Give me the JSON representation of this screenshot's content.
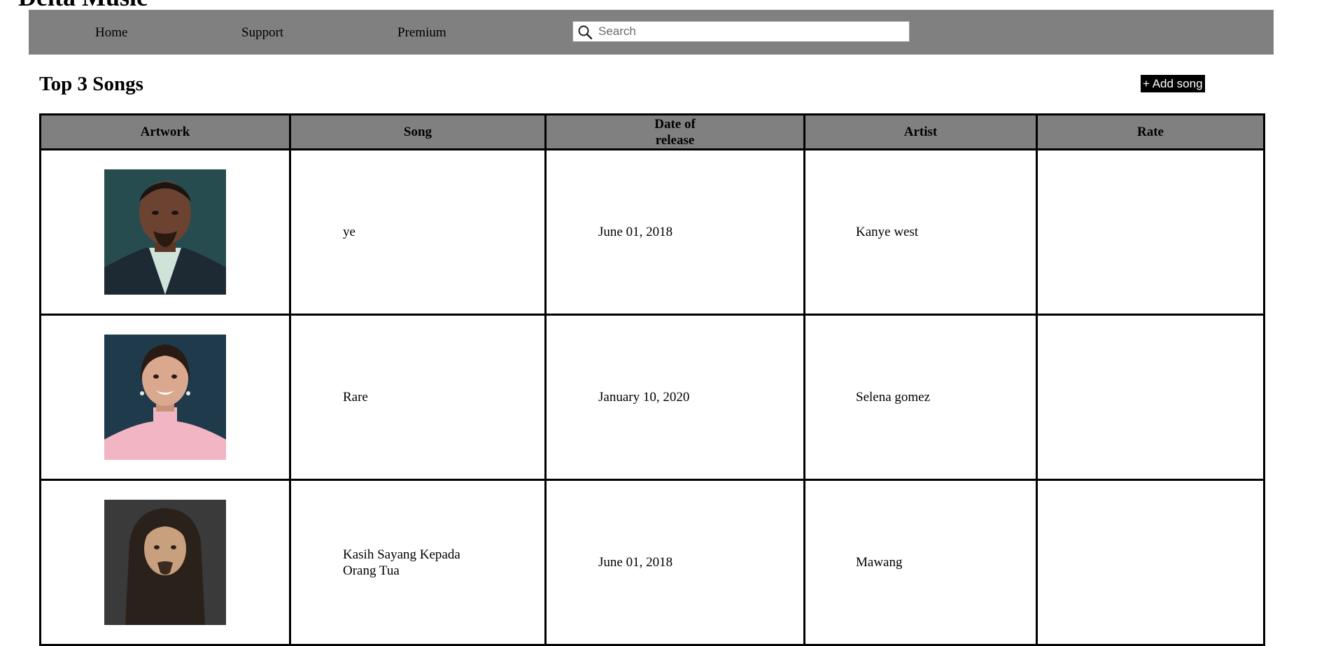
{
  "site": {
    "title": "Delta Music"
  },
  "nav": {
    "items": [
      {
        "label": "Home"
      },
      {
        "label": "Support"
      },
      {
        "label": "Premium"
      }
    ]
  },
  "search": {
    "placeholder": "Search",
    "value": ""
  },
  "main": {
    "heading": "Top 3 Songs",
    "add_button_label": "+ Add song"
  },
  "table": {
    "columns": [
      "Artwork",
      "Song",
      "Date of release",
      "Artist",
      "Rate"
    ],
    "rows": [
      {
        "song": "ye",
        "date": "June 01, 2018",
        "artist": "Kanye west",
        "rate": "",
        "artwork_colors": {
          "bg": "#2f5a5c",
          "skin": "#6b4330",
          "shirt": "#cfe3d9",
          "jacket": "#1e2a33"
        }
      },
      {
        "song": "Rare",
        "date": "January 10, 2020",
        "artist": "Selena gomez",
        "rate": "",
        "artwork_colors": {
          "bg": "#1f3a4a",
          "skin": "#d9a88f",
          "shirt": "#f2b5c4",
          "hair": "#2a1a14"
        }
      },
      {
        "song": "Kasih Sayang Kepada Orang Tua",
        "date": "June 01, 2018",
        "artist": "Mawang",
        "rate": "",
        "artwork_colors": {
          "bg": "#3a3a3a",
          "skin": "#c9a07e",
          "hair": "#2b211b"
        }
      }
    ]
  }
}
